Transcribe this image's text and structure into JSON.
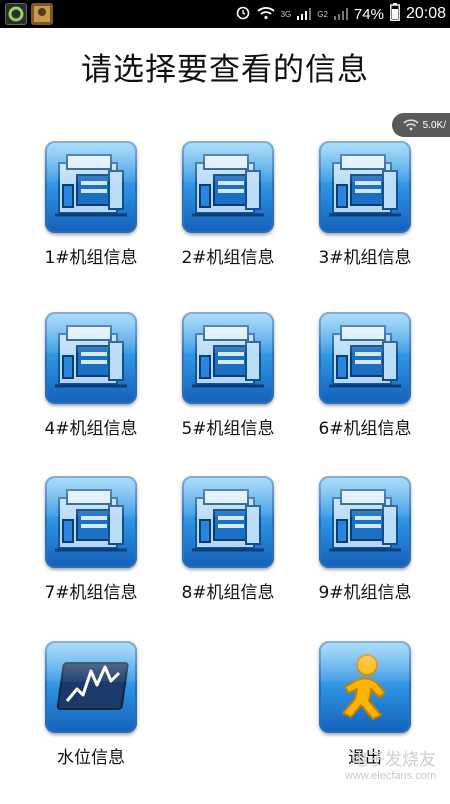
{
  "status_bar": {
    "network_3g": "3G",
    "network_g2": "G2",
    "battery": "74%",
    "time": "20:08"
  },
  "title": "请选择要查看的信息",
  "speed_indicator": "5.0K/",
  "tiles": [
    {
      "label": "1#机组信息",
      "icon": "generator-unit-icon"
    },
    {
      "label": "2#机组信息",
      "icon": "generator-unit-icon"
    },
    {
      "label": "3#机组信息",
      "icon": "generator-unit-icon"
    },
    {
      "label": "4#机组信息",
      "icon": "generator-unit-icon"
    },
    {
      "label": "5#机组信息",
      "icon": "generator-unit-icon"
    },
    {
      "label": "6#机组信息",
      "icon": "generator-unit-icon"
    },
    {
      "label": "7#机组信息",
      "icon": "generator-unit-icon"
    },
    {
      "label": "8#机组信息",
      "icon": "generator-unit-icon"
    },
    {
      "label": "9#机组信息",
      "icon": "generator-unit-icon"
    },
    {
      "label": "水位信息",
      "icon": "water-level-chart-icon"
    },
    {
      "label": "退出",
      "icon": "exit-running-man-icon"
    }
  ],
  "watermark": {
    "brand": "电子发烧友",
    "url": "www.elecfans.com"
  },
  "colors": {
    "tile_gradient_top": "#6fc3f5",
    "tile_gradient_bottom": "#1560b8",
    "status_bar_bg": "#000000"
  }
}
